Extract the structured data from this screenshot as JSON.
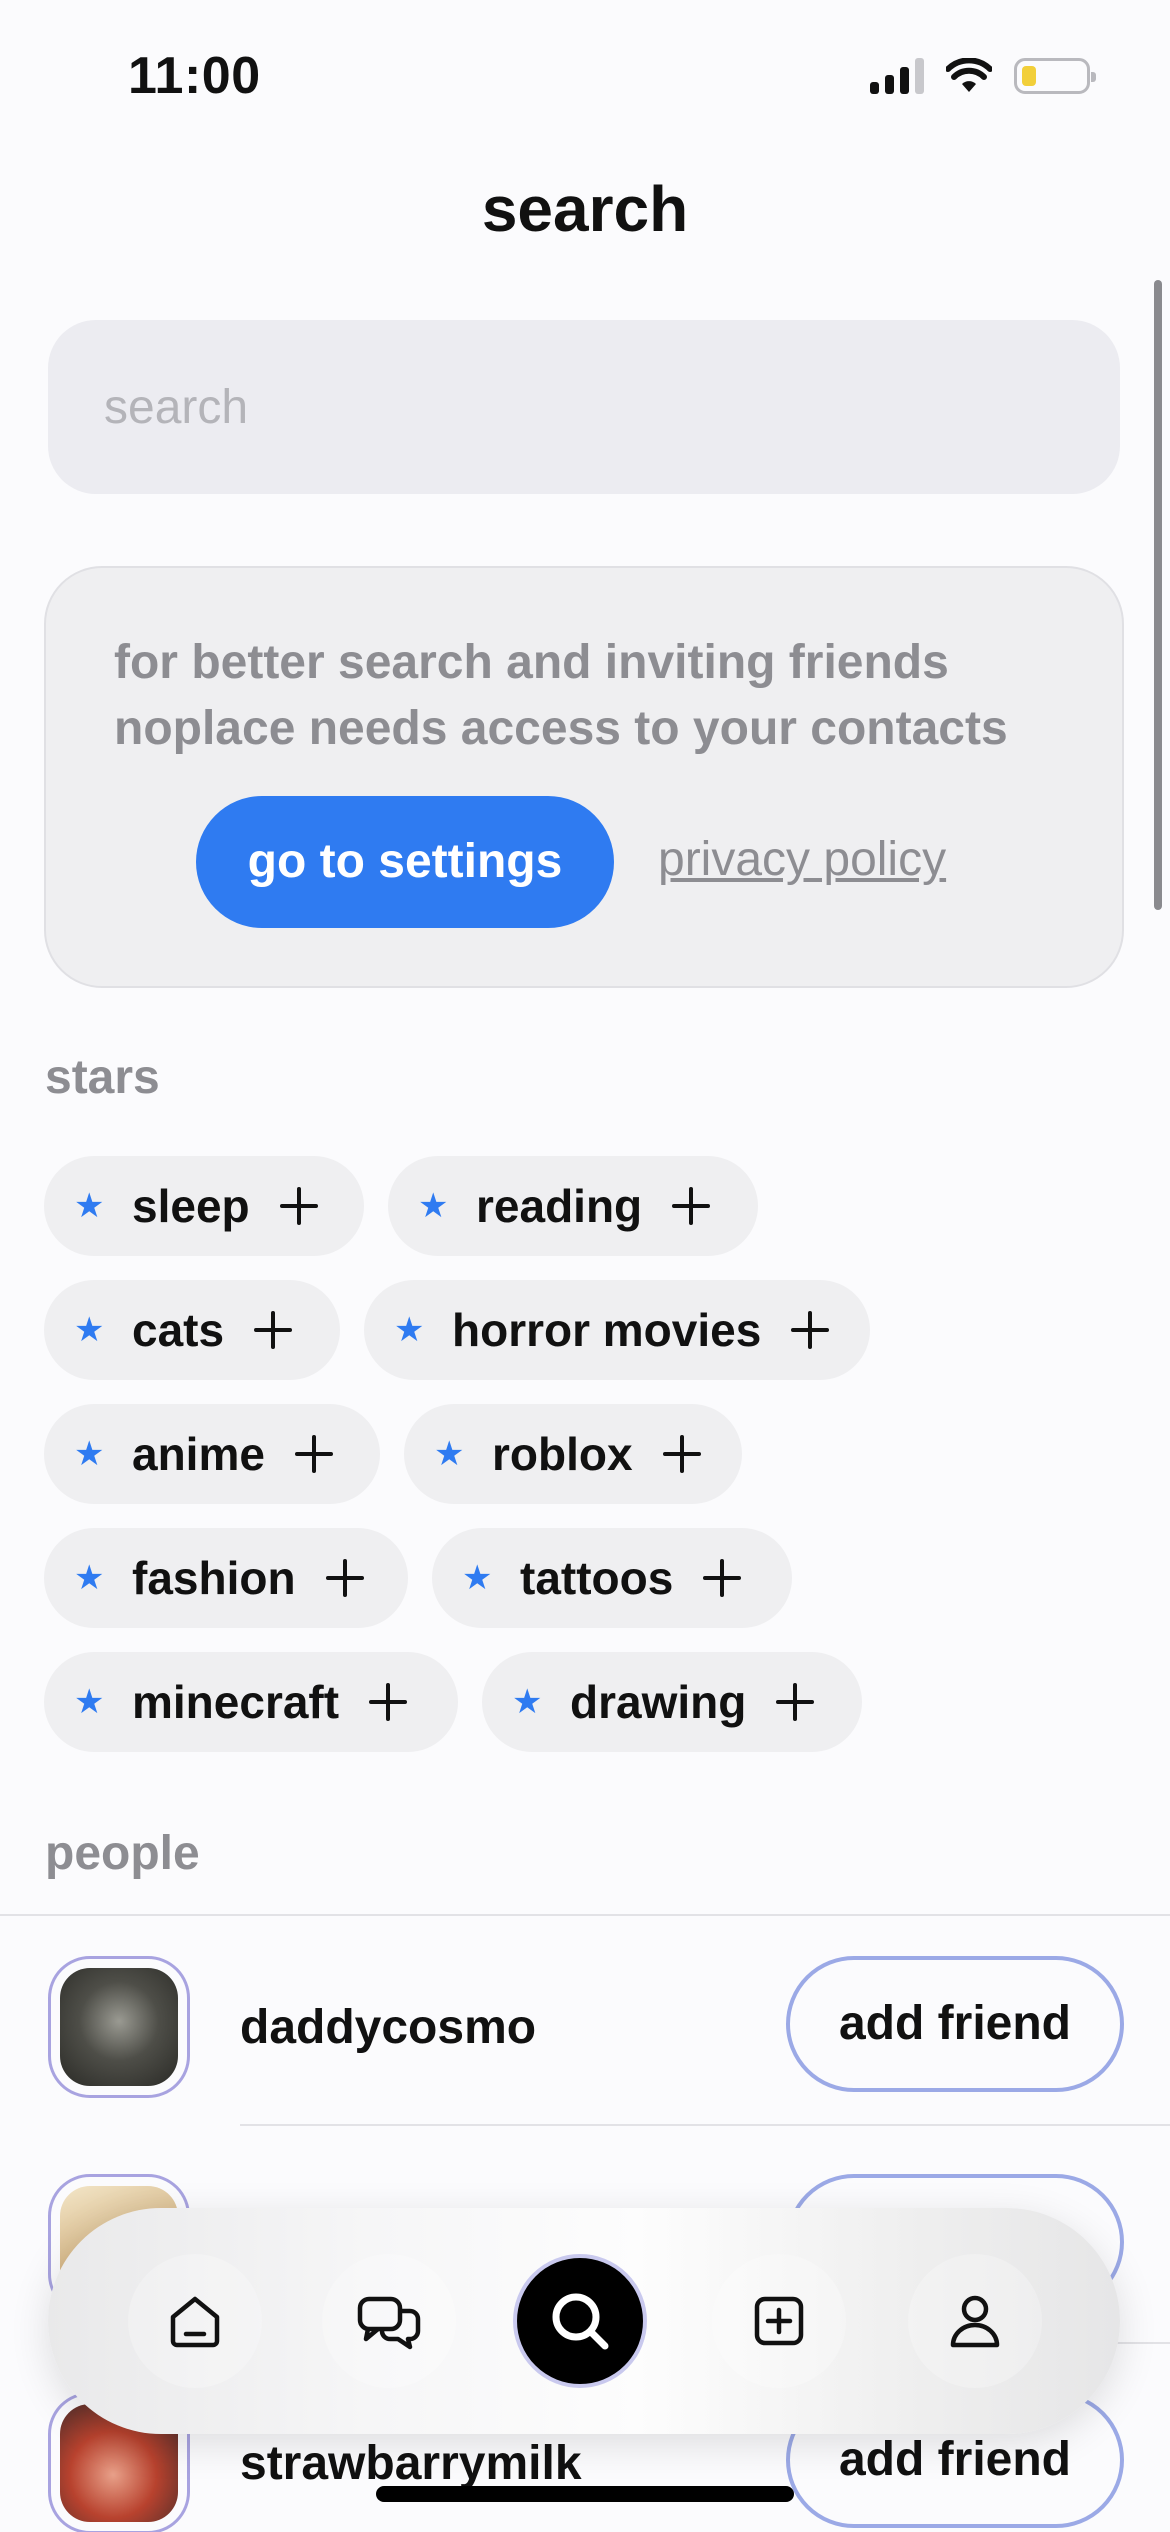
{
  "status_bar": {
    "time": "11:00"
  },
  "header": {
    "title": "search"
  },
  "search": {
    "placeholder": "search",
    "value": ""
  },
  "contacts_prompt": {
    "message": "for better search and inviting friends noplace needs access to your contacts",
    "settings_button": "go to settings",
    "privacy_link": "privacy policy"
  },
  "stars": {
    "label": "stars",
    "chips": [
      {
        "label": "sleep"
      },
      {
        "label": "reading"
      },
      {
        "label": "cats"
      },
      {
        "label": "horror movies"
      },
      {
        "label": "anime"
      },
      {
        "label": "roblox"
      },
      {
        "label": "fashion"
      },
      {
        "label": "tattoos"
      },
      {
        "label": "minecraft"
      },
      {
        "label": "drawing"
      }
    ]
  },
  "people": {
    "label": "people",
    "list": [
      {
        "username": "daddycosmo",
        "action": "add friend"
      },
      {
        "username": "",
        "action": ""
      },
      {
        "username": "strawbarrymilk",
        "action": "add friend"
      }
    ]
  },
  "tab_bar": {
    "tabs": [
      {
        "icon": "home-icon"
      },
      {
        "icon": "chat-icon"
      },
      {
        "icon": "search-icon",
        "active": true
      },
      {
        "icon": "add-post-icon"
      },
      {
        "icon": "profile-icon"
      }
    ]
  },
  "colors": {
    "accent": "#2f7bf1",
    "secondary_text": "#8d8d92",
    "avatar_ring": "#a8a3e0",
    "add_button_border": "#9ba9e6"
  }
}
